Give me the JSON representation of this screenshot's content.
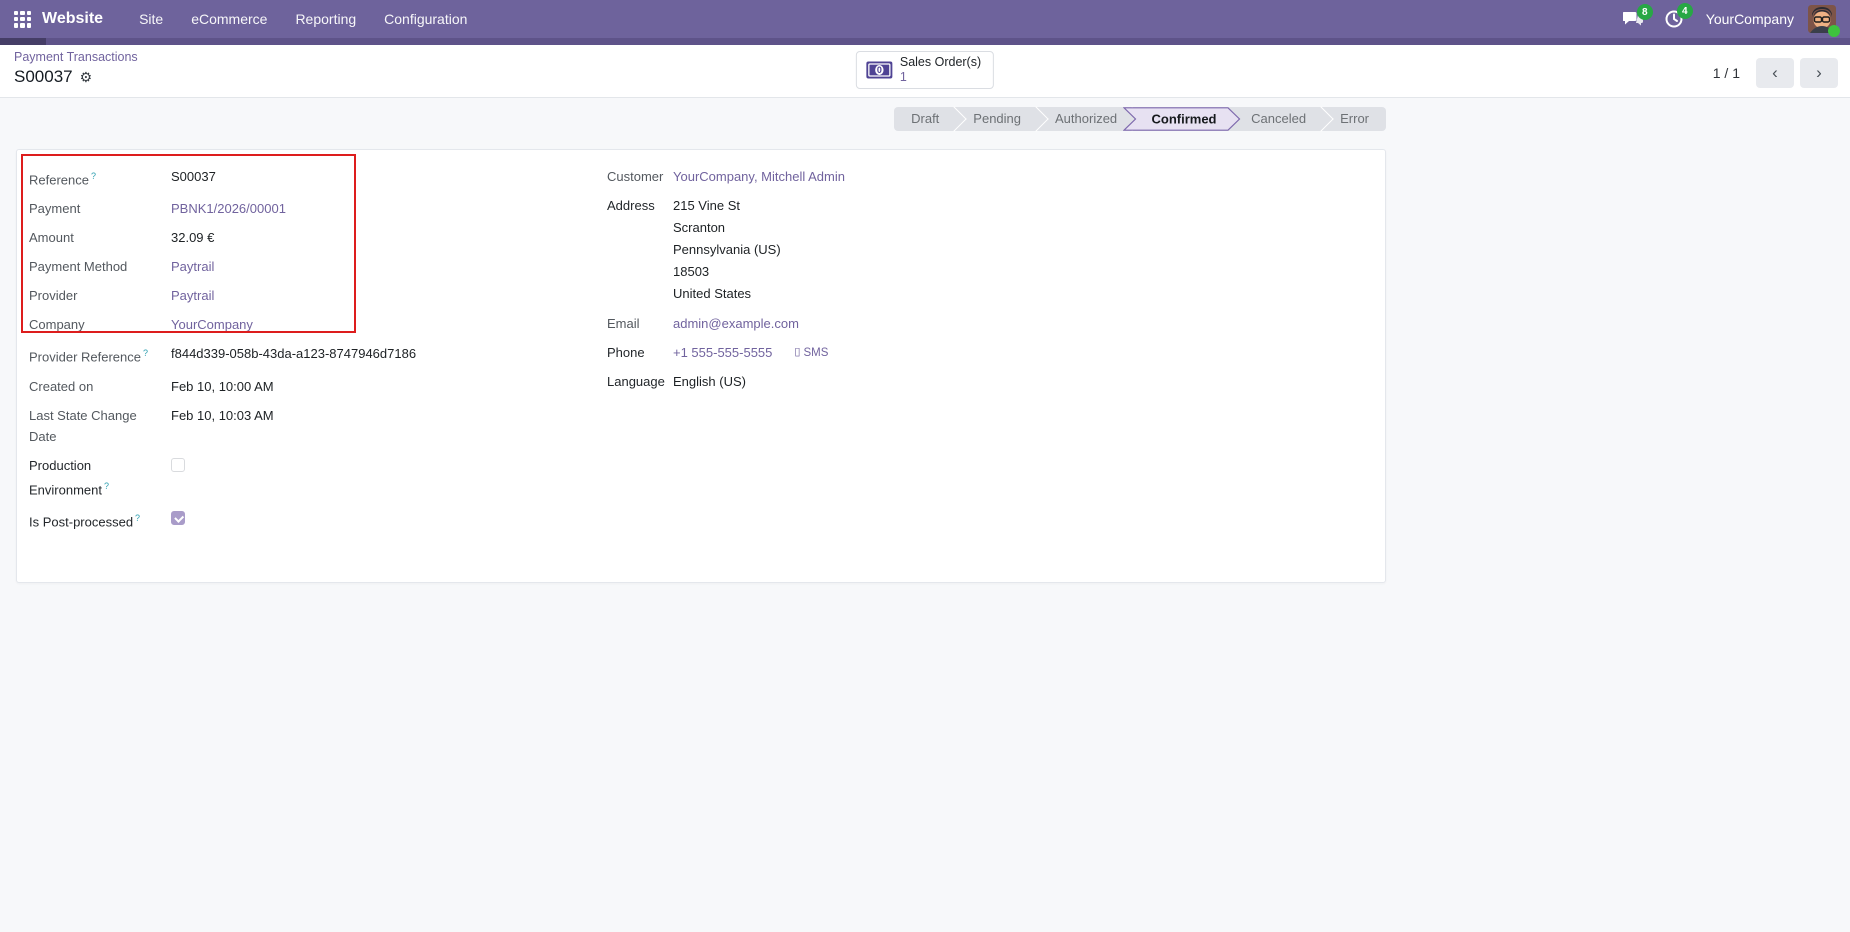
{
  "topbar": {
    "app_name": "Website",
    "menus": [
      "Site",
      "eCommerce",
      "Reporting",
      "Configuration"
    ],
    "messages_badge": "8",
    "activities_badge": "4",
    "company": "YourCompany"
  },
  "breadcrumb": {
    "parent": "Payment Transactions",
    "current": "S00037"
  },
  "icons": {
    "gear": "⚙",
    "chevron_left": "‹",
    "chevron_right": "›",
    "sms_phone": "▯",
    "help_marker": "?"
  },
  "smart_button": {
    "label": "Sales Order(s)",
    "count": "1"
  },
  "pager": {
    "value": "1 / 1"
  },
  "statusbar": {
    "steps": [
      "Draft",
      "Pending",
      "Authorized",
      "Confirmed",
      "Canceled",
      "Error"
    ],
    "active": "Confirmed"
  },
  "fields_left": [
    {
      "label": "Reference",
      "value": "S00037"
    },
    {
      "label": "Payment",
      "value": "PBNK1/2026/00001"
    },
    {
      "label": "Amount",
      "value": "32.09 €"
    },
    {
      "label": "Payment Method",
      "value": "Paytrail"
    },
    {
      "label": "Provider",
      "value": "Paytrail"
    },
    {
      "label": "Company",
      "value": "YourCompany"
    },
    {
      "label": "Provider Reference",
      "value": "f844d339-058b-43da-a123-8747946d7186"
    },
    {
      "label": "Created on",
      "value": "Feb 10, 10:00 AM"
    },
    {
      "label": "Last State Change Date",
      "value": "Feb 10, 10:03 AM"
    },
    {
      "label": "Production Environment",
      "value": "unchecked"
    },
    {
      "label": "Is Post-processed",
      "value": "checked"
    }
  ],
  "fields_right": {
    "customer": {
      "label": "Customer",
      "value": "YourCompany, Mitchell Admin"
    },
    "address": {
      "label": "Address",
      "lines": [
        "215 Vine St",
        "Scranton",
        "Pennsylvania (US)",
        "18503",
        "United States"
      ]
    },
    "email": {
      "label": "Email",
      "value": "admin@example.com"
    },
    "phone": {
      "label": "Phone",
      "value": "+1 555-555-5555",
      "sms_label": "SMS"
    },
    "language": {
      "label": "Language",
      "value": "English (US)"
    }
  },
  "colors": {
    "topbar": "#6e639c",
    "accent_link": "#71639e",
    "highlight_border": "#dd1d1d",
    "badge_green": "#28a745",
    "statusbar_bg": "#dfe1e6",
    "active_step_bg": "#e7e1f2",
    "active_step_border": "#7e69ad"
  }
}
